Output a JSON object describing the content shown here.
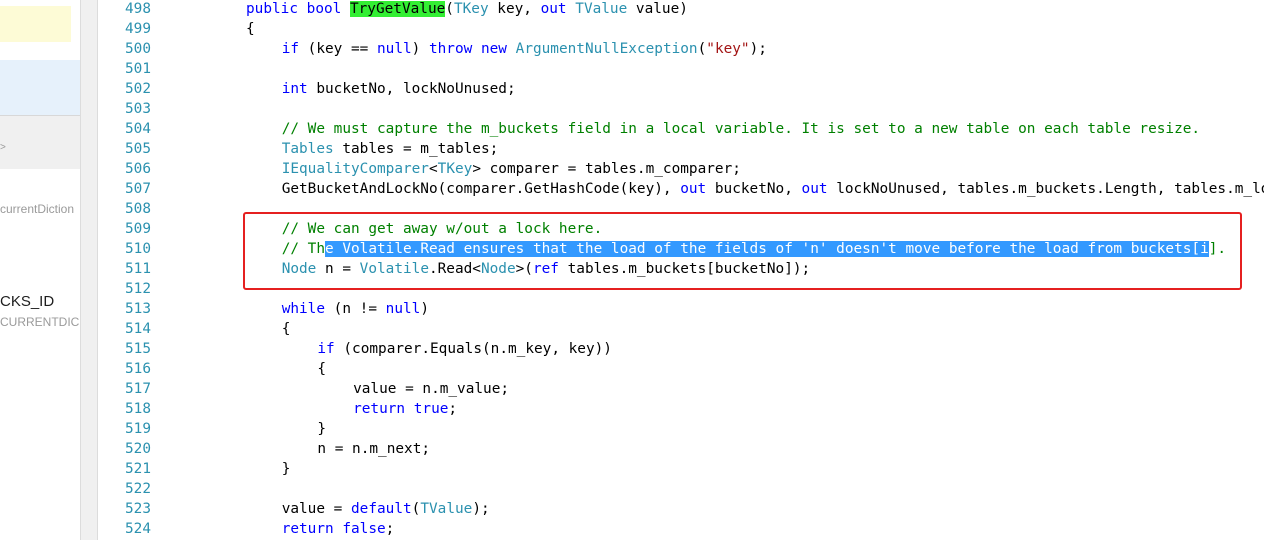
{
  "left_panel": {
    "text1": "currentDiction",
    "text2": "CKS_ID",
    "text3": "CURRENTDIC",
    "chevron": ">"
  },
  "editor": {
    "lines": [
      {
        "no": "498",
        "indent": 0,
        "tokens": [
          [
            "kw",
            "public"
          ],
          [
            "p",
            " "
          ],
          [
            "kw",
            "bool"
          ],
          [
            "p",
            " "
          ],
          [
            "mhl",
            "TryGetValue"
          ],
          [
            "p",
            "("
          ],
          [
            "ty",
            "TKey"
          ],
          [
            "p",
            " key, "
          ],
          [
            "kw",
            "out"
          ],
          [
            "p",
            " "
          ],
          [
            "ty",
            "TValue"
          ],
          [
            "p",
            " value)"
          ]
        ]
      },
      {
        "no": "499",
        "indent": 0,
        "tokens": [
          [
            "p",
            "{"
          ]
        ]
      },
      {
        "no": "500",
        "indent": 1,
        "tokens": [
          [
            "kw",
            "if"
          ],
          [
            "p",
            " (key == "
          ],
          [
            "kw",
            "null"
          ],
          [
            "p",
            ") "
          ],
          [
            "kw",
            "throw"
          ],
          [
            "p",
            " "
          ],
          [
            "kw",
            "new"
          ],
          [
            "p",
            " "
          ],
          [
            "ty",
            "ArgumentNullException"
          ],
          [
            "p",
            "("
          ],
          [
            "str",
            "\"key\""
          ],
          [
            "p",
            ");"
          ]
        ]
      },
      {
        "no": "501",
        "indent": 0,
        "tokens": []
      },
      {
        "no": "502",
        "indent": 1,
        "tokens": [
          [
            "kw",
            "int"
          ],
          [
            "p",
            " bucketNo, lockNoUnused;"
          ]
        ]
      },
      {
        "no": "503",
        "indent": 0,
        "tokens": []
      },
      {
        "no": "504",
        "indent": 1,
        "tokens": [
          [
            "cm",
            "// We must capture the m_buckets field in a local variable. It is set to a new table on each table resize."
          ]
        ]
      },
      {
        "no": "505",
        "indent": 1,
        "tokens": [
          [
            "ty",
            "Tables"
          ],
          [
            "p",
            " tables = m_tables;"
          ]
        ]
      },
      {
        "no": "506",
        "indent": 1,
        "tokens": [
          [
            "ty",
            "IEqualityComparer"
          ],
          [
            "p",
            "<"
          ],
          [
            "ty",
            "TKey"
          ],
          [
            "p",
            "> comparer = tables.m_comparer;"
          ]
        ]
      },
      {
        "no": "507",
        "indent": 1,
        "tokens": [
          [
            "p",
            "GetBucketAndLockNo(comparer.GetHashCode(key), "
          ],
          [
            "kw",
            "out"
          ],
          [
            "p",
            " bucketNo, "
          ],
          [
            "kw",
            "out"
          ],
          [
            "p",
            " lockNoUnused, tables.m_buckets.Length, tables.m_locks.Length);"
          ]
        ]
      },
      {
        "no": "508",
        "indent": 0,
        "tokens": []
      },
      {
        "no": "509",
        "indent": 1,
        "tokens": [
          [
            "cm",
            "// We can get away w/out a lock here."
          ]
        ]
      },
      {
        "no": "510",
        "indent": 1,
        "tokens": [
          [
            "cm",
            "// Th"
          ],
          [
            "sel",
            "e Volatile.Read ensures that the load of the fields of 'n' doesn't move before the load from buckets[i"
          ],
          [
            "cm",
            "]."
          ]
        ]
      },
      {
        "no": "511",
        "indent": 1,
        "tokens": [
          [
            "ty",
            "Node"
          ],
          [
            "p",
            " n = "
          ],
          [
            "ty",
            "Volatile"
          ],
          [
            "p",
            ".Read<"
          ],
          [
            "ty",
            "Node"
          ],
          [
            "p",
            ">("
          ],
          [
            "kw",
            "ref"
          ],
          [
            "p",
            " tables.m_buckets[bucketNo]);"
          ]
        ]
      },
      {
        "no": "512",
        "indent": 0,
        "tokens": []
      },
      {
        "no": "513",
        "indent": 1,
        "tokens": [
          [
            "kw",
            "while"
          ],
          [
            "p",
            " (n != "
          ],
          [
            "kw",
            "null"
          ],
          [
            "p",
            ")"
          ]
        ]
      },
      {
        "no": "514",
        "indent": 1,
        "tokens": [
          [
            "p",
            "{"
          ]
        ]
      },
      {
        "no": "515",
        "indent": 2,
        "tokens": [
          [
            "kw",
            "if"
          ],
          [
            "p",
            " (comparer.Equals(n.m_key, key))"
          ]
        ]
      },
      {
        "no": "516",
        "indent": 2,
        "tokens": [
          [
            "p",
            "{"
          ]
        ]
      },
      {
        "no": "517",
        "indent": 3,
        "tokens": [
          [
            "p",
            "value = n.m_value;"
          ]
        ]
      },
      {
        "no": "518",
        "indent": 3,
        "tokens": [
          [
            "kw",
            "return"
          ],
          [
            "p",
            " "
          ],
          [
            "kw",
            "true"
          ],
          [
            "p",
            ";"
          ]
        ]
      },
      {
        "no": "519",
        "indent": 2,
        "tokens": [
          [
            "p",
            "}"
          ]
        ]
      },
      {
        "no": "520",
        "indent": 2,
        "tokens": [
          [
            "p",
            "n = n.m_next;"
          ]
        ]
      },
      {
        "no": "521",
        "indent": 1,
        "tokens": [
          [
            "p",
            "}"
          ]
        ]
      },
      {
        "no": "522",
        "indent": 0,
        "tokens": []
      },
      {
        "no": "523",
        "indent": 1,
        "tokens": [
          [
            "p",
            "value = "
          ],
          [
            "kw",
            "default"
          ],
          [
            "p",
            "("
          ],
          [
            "ty",
            "TValue"
          ],
          [
            "p",
            ");"
          ]
        ]
      },
      {
        "no": "524",
        "indent": 1,
        "tokens": [
          [
            "kw",
            "return"
          ],
          [
            "p",
            " "
          ],
          [
            "kw",
            "false"
          ],
          [
            "p",
            ";"
          ]
        ]
      }
    ]
  },
  "colors": {
    "keyword": "#0000ff",
    "type": "#2b91af",
    "string": "#a31515",
    "comment": "#008000",
    "line_number": "#2b91af",
    "match_highlight": "#33ee33",
    "selection": "#3399ff",
    "annotation_box": "#e52020"
  }
}
